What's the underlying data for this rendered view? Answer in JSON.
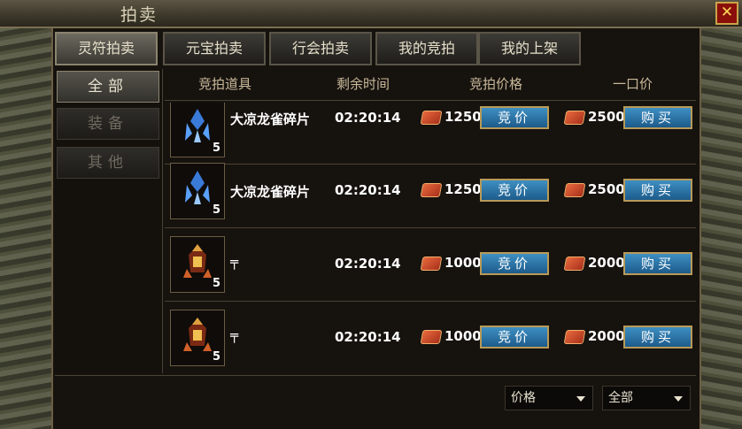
{
  "window": {
    "title": "拍卖",
    "close_glyph": "✕"
  },
  "tabs": [
    {
      "label": "灵符拍卖",
      "active": true
    },
    {
      "label": "元宝拍卖",
      "active": false
    },
    {
      "label": "行会拍卖",
      "active": false
    },
    {
      "label": "我的竞拍",
      "active": false
    },
    {
      "label": "我的上架",
      "active": false
    }
  ],
  "categories": [
    {
      "label": "全部",
      "active": true
    },
    {
      "label": "装备",
      "active": false
    },
    {
      "label": "其他",
      "active": false
    }
  ],
  "columns": {
    "item": "竞拍道具",
    "time": "剩余时间",
    "bid_price": "竞拍价格",
    "buyout_price": "一口价"
  },
  "rows": [
    {
      "name": "大凉龙雀碎片",
      "count": "5",
      "time": "02:20:14",
      "bid": "1250",
      "buyout": "2500",
      "bid_btn": "竞价",
      "buy_btn": "购买",
      "icon": "blue-crystal-icon"
    },
    {
      "name": "大凉龙雀碎片",
      "count": "5",
      "time": "02:20:14",
      "bid": "1250",
      "buyout": "2500",
      "bid_btn": "竞价",
      "buy_btn": "购买",
      "icon": "blue-crystal-icon"
    },
    {
      "name": "╤",
      "count": "5",
      "time": "02:20:14",
      "bid": "1000",
      "buyout": "2000",
      "bid_btn": "竞价",
      "buy_btn": "购买",
      "icon": "fire-armor-icon"
    },
    {
      "name": "╤",
      "count": "5",
      "time": "02:20:14",
      "bid": "1000",
      "buyout": "2000",
      "bid_btn": "竞价",
      "buy_btn": "购买",
      "icon": "fire-armor-icon"
    }
  ],
  "filters": {
    "sort": "价格",
    "scope": "全部"
  },
  "colors": {
    "bid_button": "#2f7bb2",
    "accent_gold": "#b89a58"
  }
}
